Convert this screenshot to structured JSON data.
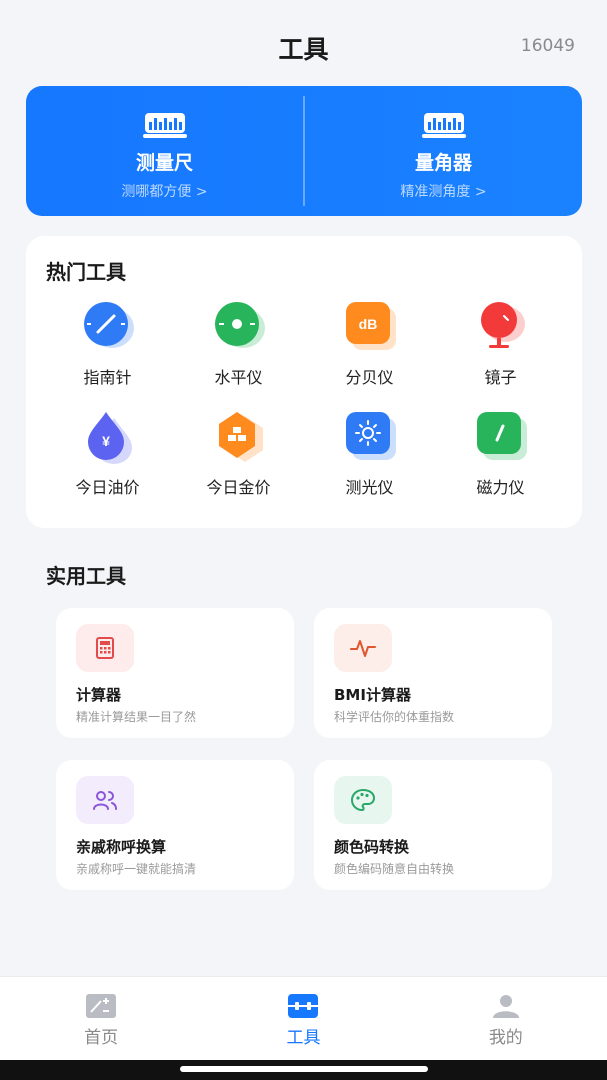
{
  "header": {
    "title": "工具",
    "count": "16049"
  },
  "banner": [
    {
      "title": "测量尺",
      "sub": "测哪都方便 >",
      "icon": "ruler-icon"
    },
    {
      "title": "量角器",
      "sub": "精准测角度 >",
      "icon": "ruler-icon"
    }
  ],
  "hot_tools": {
    "title": "热门工具",
    "items": [
      {
        "label": "指南针",
        "icon": "compass-icon",
        "color": "#2f7bf5"
      },
      {
        "label": "水平仪",
        "icon": "level-icon",
        "color": "#27b45a"
      },
      {
        "label": "分贝仪",
        "icon": "decibel-icon",
        "color": "#ff8a1e"
      },
      {
        "label": "镜子",
        "icon": "mirror-icon",
        "color": "#f33a3a"
      },
      {
        "label": "今日油价",
        "icon": "oil-price-icon",
        "color": "#5b63f0"
      },
      {
        "label": "今日金价",
        "icon": "gold-price-icon",
        "color": "#ff8a1e"
      },
      {
        "label": "测光仪",
        "icon": "light-meter-icon",
        "color": "#2f7bf5"
      },
      {
        "label": "磁力仪",
        "icon": "magnetometer-icon",
        "color": "#27b45a"
      }
    ]
  },
  "utility": {
    "title": "实用工具",
    "items": [
      {
        "title": "计算器",
        "sub": "精准计算结果一目了然",
        "icon": "calculator-icon",
        "color": "#e24b4b",
        "bg": "#fdeceb"
      },
      {
        "title": "BMI计算器",
        "sub": "科学评估你的体重指数",
        "icon": "pulse-icon",
        "color": "#e0562e",
        "bg": "#fdeee9"
      },
      {
        "title": "亲戚称呼换算",
        "sub": "亲戚称呼一键就能搞清",
        "icon": "people-icon",
        "color": "#8a55d8",
        "bg": "#f2ecfc"
      },
      {
        "title": "颜色码转换",
        "sub": "颜色编码随意自由转换",
        "icon": "palette-icon",
        "color": "#2aa86a",
        "bg": "#e7f7ef"
      }
    ]
  },
  "nav": [
    {
      "label": "首页",
      "icon": "home-icon",
      "active": false
    },
    {
      "label": "工具",
      "icon": "tools-icon",
      "active": true
    },
    {
      "label": "我的",
      "icon": "profile-icon",
      "active": false
    }
  ],
  "colors": {
    "accent": "#1677ff",
    "background": "#f3f5f8"
  }
}
